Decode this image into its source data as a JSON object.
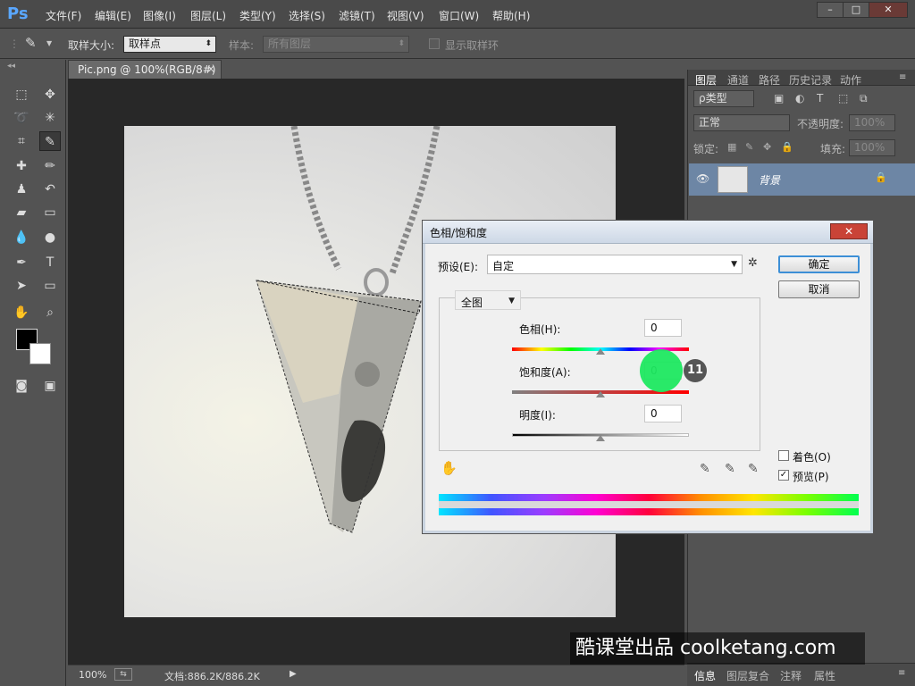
{
  "app": {
    "logo": "Ps",
    "menu": [
      "文件(F)",
      "编辑(E)",
      "图像(I)",
      "图层(L)",
      "类型(Y)",
      "选择(S)",
      "滤镜(T)",
      "视图(V)",
      "窗口(W)",
      "帮助(H)"
    ],
    "window_buttons": [
      "–",
      "□",
      "✕"
    ]
  },
  "options_bar": {
    "sample_size_label": "取样大小:",
    "sample_size_value": "取样点",
    "sample_label": "样本:",
    "sample_value": "所有图层",
    "show_ring_label": "显示取样环"
  },
  "document": {
    "tab_label": "Pic.png @ 100%(RGB/8#)",
    "close_glyph": "×"
  },
  "status_bar": {
    "zoom": "100%",
    "doc_info": "文档:886.2K/886.2K"
  },
  "layers_panel": {
    "tabs": [
      "图层",
      "通道",
      "路径",
      "历史记录",
      "动作"
    ],
    "filter_kind": "ρ类型",
    "blend_mode": "正常",
    "opacity_label": "不透明度:",
    "opacity_value": "100%",
    "lock_label": "锁定:",
    "fill_label": "填充:",
    "fill_value": "100%",
    "layer_name": "背景"
  },
  "bottom_panel": {
    "tabs": [
      "信息",
      "图层复合",
      "注释",
      "属性"
    ]
  },
  "dialog": {
    "title": "色相/饱和度",
    "close": "✕",
    "preset_label": "预设(E):",
    "preset_value": "自定",
    "ok": "确定",
    "cancel": "取消",
    "channel": "全图",
    "hue_label": "色相(H):",
    "hue_value": "0",
    "saturation_label": "饱和度(A):",
    "saturation_value": "0",
    "lightness_label": "明度(I):",
    "lightness_value": "0",
    "colorize_label": "着色(O)",
    "preview_label": "预览(P)",
    "colorize_checked": false,
    "preview_checked": true
  },
  "overlay": {
    "step": "11",
    "watermark": "酷课堂出品 coolketang.com"
  }
}
